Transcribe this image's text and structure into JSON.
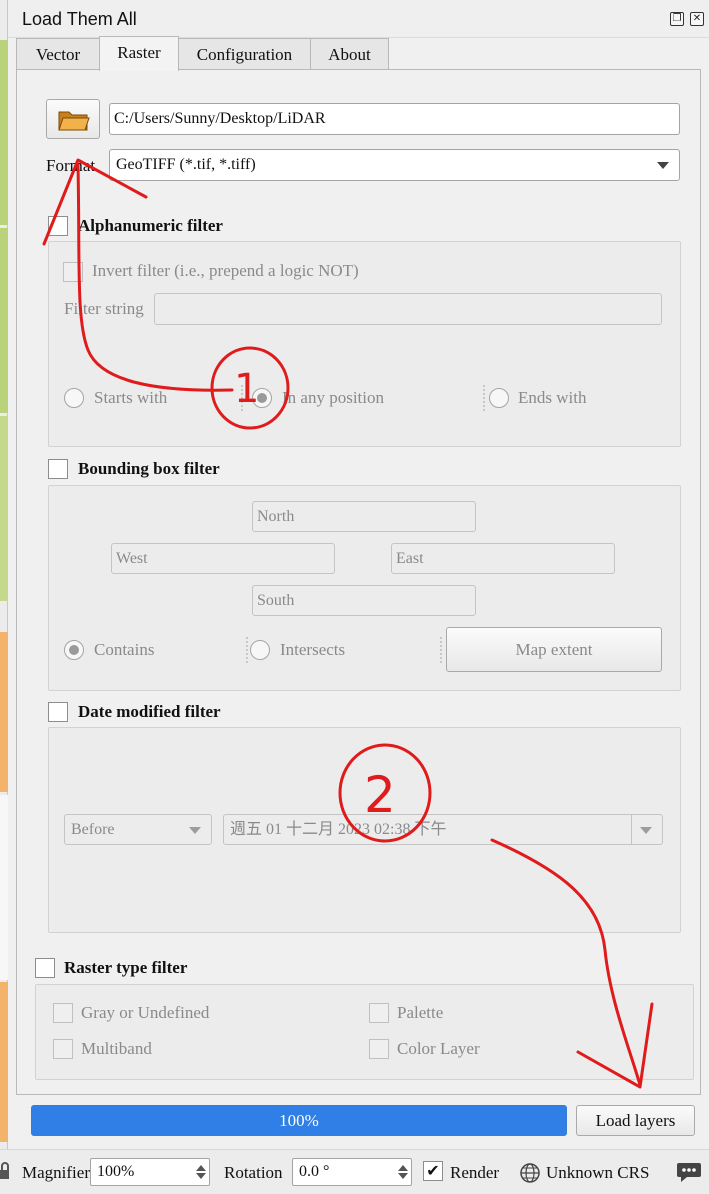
{
  "window": {
    "title": "Load Them All",
    "restore_glyph": "❐",
    "close_glyph": "✕"
  },
  "tabs": [
    {
      "label": "Vector",
      "active": false
    },
    {
      "label": "Raster",
      "active": true
    },
    {
      "label": "Configuration",
      "active": false
    },
    {
      "label": "About",
      "active": false
    }
  ],
  "directory": {
    "button_icon": "folder-icon",
    "path": "C:/Users/Sunny/Desktop/LiDAR"
  },
  "format": {
    "label": "Format",
    "value": "GeoTIFF (*.tif, *.tiff)"
  },
  "alphanumeric_filter": {
    "label": "Alphanumeric filter",
    "checked": false,
    "invert_label": "Invert filter (i.e., prepend a logic NOT)",
    "invert_checked": false,
    "filter_string_label": "Filter string",
    "filter_string_value": "",
    "positions": [
      {
        "label": "Starts with",
        "selected": false
      },
      {
        "label": "In any position",
        "selected": true
      },
      {
        "label": "Ends with",
        "selected": false
      }
    ]
  },
  "bounding_box_filter": {
    "label": "Bounding box filter",
    "checked": false,
    "north_placeholder": "North",
    "west_placeholder": "West",
    "east_placeholder": "East",
    "south_placeholder": "South",
    "modes": [
      {
        "label": "Contains",
        "selected": true
      },
      {
        "label": "Intersects",
        "selected": false
      }
    ],
    "map_extent_label": "Map extent"
  },
  "date_modified_filter": {
    "label": "Date modified filter",
    "checked": false,
    "comparison": "Before",
    "datetime": "週五 01 十二月 2023 02:38 下午"
  },
  "raster_type_filter": {
    "label": "Raster type filter",
    "checked": false,
    "types": [
      {
        "label": "Gray or Undefined",
        "checked": false
      },
      {
        "label": "Palette",
        "checked": false
      },
      {
        "label": "Multiband",
        "checked": false
      },
      {
        "label": "Color Layer",
        "checked": false
      }
    ]
  },
  "progress": {
    "value": 1.0,
    "text": "100%"
  },
  "load_layers_label": "Load layers",
  "statusbar": {
    "magnifier_label": "Magnifier",
    "magnifier_value": "100%",
    "rotation_label": "Rotation",
    "rotation_value": "0.0 °",
    "render_label": "Render",
    "render_checked": true,
    "crs_label": "Unknown CRS"
  },
  "annotations": {
    "marker_1": "1",
    "marker_2": "2",
    "ink_color": "#e01b1b"
  },
  "colors": {
    "progress_fill": "#2f7fe6",
    "folder": "#e8a33a"
  }
}
